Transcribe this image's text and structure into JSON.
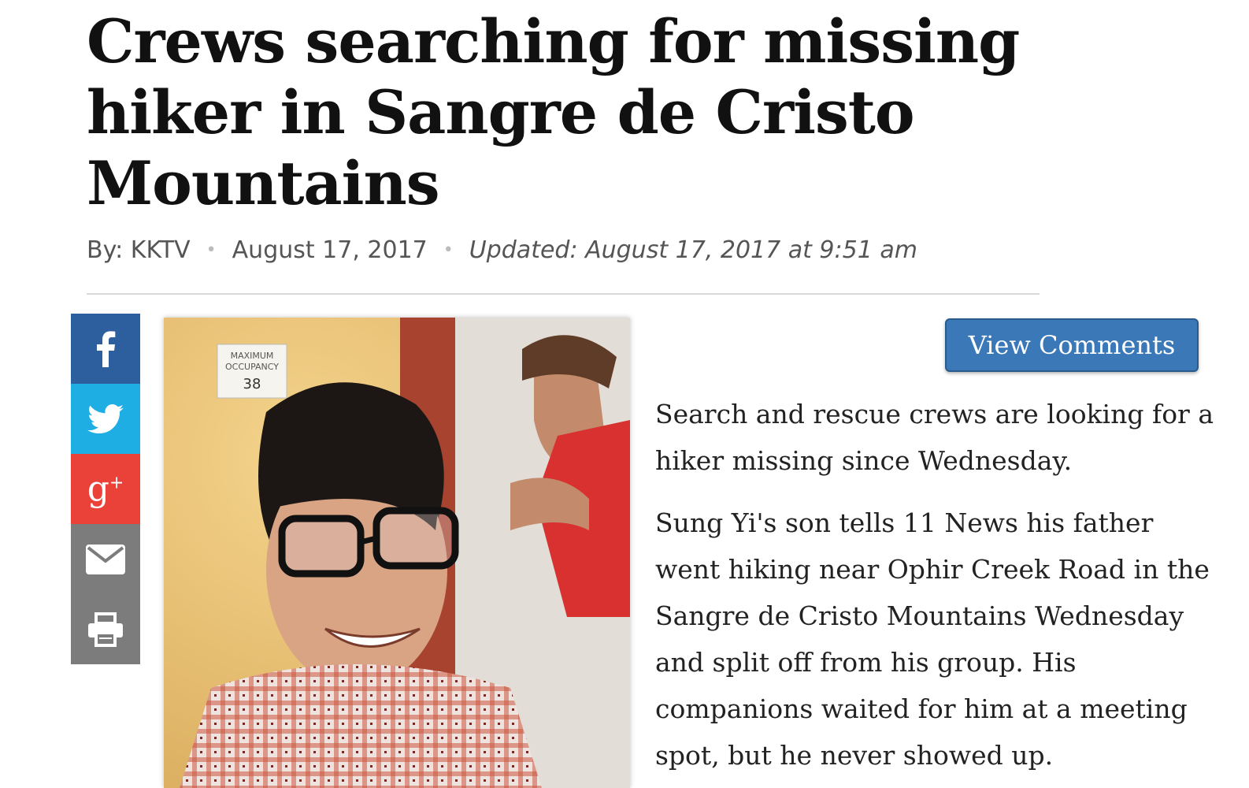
{
  "article": {
    "headline": "Crews searching for missing hiker in Sangre de Cristo Mountains",
    "byline": "By: KKTV",
    "date": "August 17, 2017",
    "updated": "Updated: August 17, 2017 at 9:51 am",
    "paragraphs": [
      "Search and rescue crews are looking for a hiker missing since Wednesday.",
      "Sung Yi's son tells 11 News his father went hiking near Ophir Creek Road in the Sangre de Cristo Mountains Wednesday and split off from his group. His companions waited for him at a meeting spot, but he never showed up."
    ]
  },
  "photo": {
    "sign_line1": "MAXIMUM",
    "sign_line2": "OCCUPANCY",
    "sign_number": "38"
  },
  "buttons": {
    "view_comments": "View Comments"
  },
  "share": {
    "icons": [
      "facebook-icon",
      "twitter-icon",
      "google-plus-icon",
      "email-icon",
      "print-icon"
    ],
    "colors": {
      "facebook": "#2d5e9e",
      "twitter": "#1eaee3",
      "google_plus": "#ea4239",
      "email": "#7c7c7c",
      "print": "#7c7c7c"
    }
  }
}
